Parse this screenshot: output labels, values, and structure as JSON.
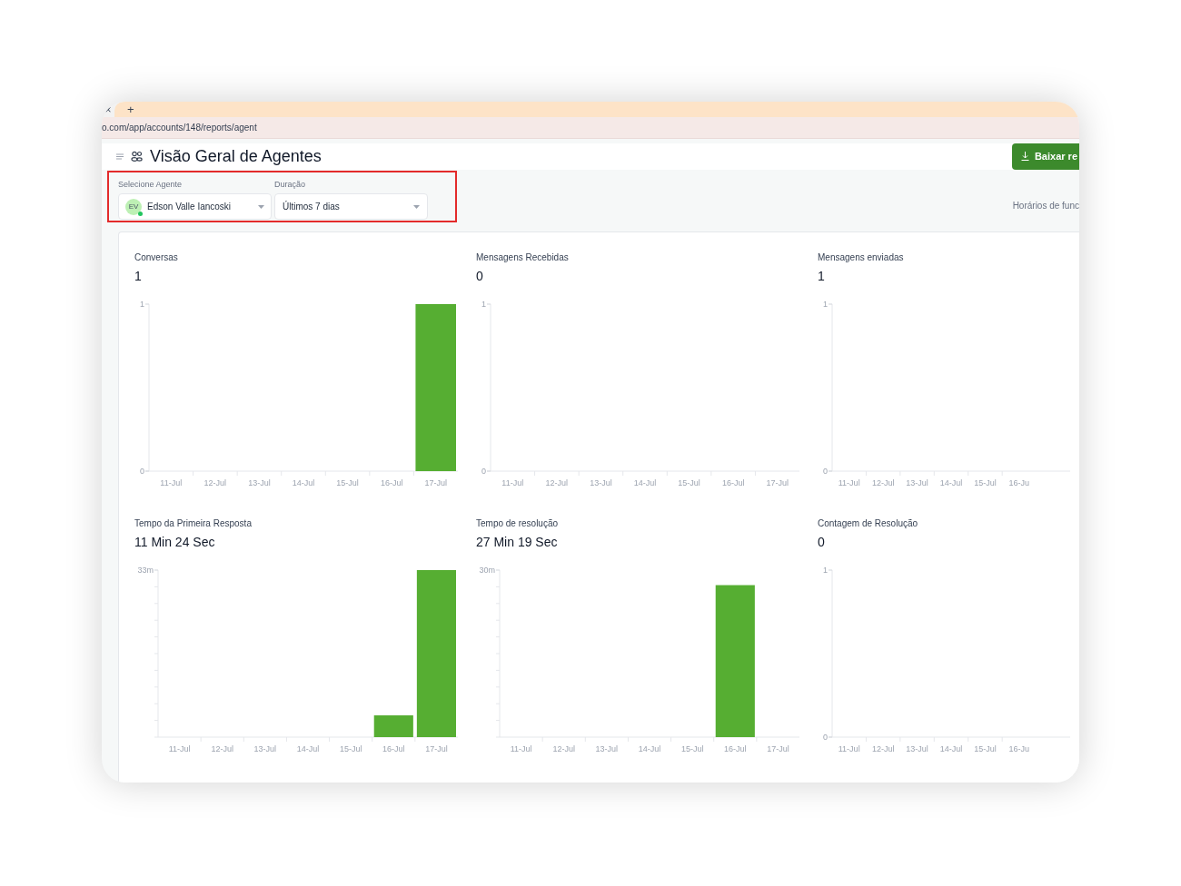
{
  "browser": {
    "tab_close": "×",
    "new_tab": "+",
    "url": "o.com/app/accounts/148/reports/agent"
  },
  "header": {
    "title": "Visão Geral de Agentes",
    "download_button": "Baixar re"
  },
  "filters": {
    "agent": {
      "label": "Selecione Agente",
      "avatar": "EV",
      "value": "Edson Valle Iancoski"
    },
    "duration": {
      "label": "Duração",
      "value": "Últimos 7 dias"
    },
    "business_hours": "Horários de func"
  },
  "metrics": [
    {
      "title": "Conversas",
      "value": "1",
      "kind": "count",
      "chart_data": {
        "type": "bar",
        "categories": [
          "11-Jul",
          "12-Jul",
          "13-Jul",
          "14-Jul",
          "15-Jul",
          "16-Jul",
          "17-Jul"
        ],
        "values": [
          0,
          0,
          0,
          0,
          0,
          0,
          1
        ],
        "ylim": [
          0,
          1
        ],
        "yticks": [
          {
            "value": 0,
            "label": "0"
          },
          {
            "value": 1,
            "label": "1"
          }
        ]
      }
    },
    {
      "title": "Mensagens Recebidas",
      "value": "0",
      "kind": "count",
      "chart_data": {
        "type": "bar",
        "categories": [
          "11-Jul",
          "12-Jul",
          "13-Jul",
          "14-Jul",
          "15-Jul",
          "16-Jul",
          "17-Jul"
        ],
        "values": [
          0,
          0,
          0,
          0,
          0,
          0,
          0
        ],
        "ylim": [
          0,
          1
        ],
        "yticks": [
          {
            "value": 0,
            "label": "0"
          },
          {
            "value": 1,
            "label": "1"
          }
        ]
      }
    },
    {
      "title": "Mensagens enviadas",
      "value": "1",
      "kind": "count",
      "chart_data": {
        "type": "bar",
        "categories": [
          "11-Jul",
          "12-Jul",
          "13-Jul",
          "14-Jul",
          "15-Jul",
          "16-Ju"
        ],
        "values": [
          0,
          0,
          0,
          0,
          0,
          0
        ],
        "ylim": [
          0,
          1
        ],
        "yticks": [
          {
            "value": 0,
            "label": "0"
          },
          {
            "value": 1,
            "label": "1"
          }
        ]
      }
    },
    {
      "title": "Tempo da Primeira Resposta",
      "value": "11 Min 24 Sec",
      "kind": "duration",
      "chart_data": {
        "type": "bar",
        "categories": [
          "11-Jul",
          "12-Jul",
          "13-Jul",
          "14-Jul",
          "15-Jul",
          "16-Jul",
          "17-Jul"
        ],
        "values": [
          0,
          0,
          0,
          0,
          0,
          4.3,
          33
        ],
        "ylim": [
          0,
          33
        ],
        "yticks": [
          {
            "value": 33,
            "label": "33m"
          }
        ]
      }
    },
    {
      "title": "Tempo de resolução",
      "value": "27 Min 19 Sec",
      "kind": "duration",
      "chart_data": {
        "type": "bar",
        "categories": [
          "11-Jul",
          "12-Jul",
          "13-Jul",
          "14-Jul",
          "15-Jul",
          "16-Jul",
          "17-Jul"
        ],
        "values": [
          0,
          0,
          0,
          0,
          0,
          27.3,
          0
        ],
        "ylim": [
          0,
          30
        ],
        "yticks": [
          {
            "value": 30,
            "label": "30m"
          }
        ]
      }
    },
    {
      "title": "Contagem de Resolução",
      "value": "0",
      "kind": "count",
      "chart_data": {
        "type": "bar",
        "categories": [
          "11-Jul",
          "12-Jul",
          "13-Jul",
          "14-Jul",
          "15-Jul",
          "16-Ju"
        ],
        "values": [
          0,
          0,
          0,
          0,
          0,
          0
        ],
        "ylim": [
          0,
          1
        ],
        "yticks": [
          {
            "value": 0,
            "label": "0"
          },
          {
            "value": 1,
            "label": "1"
          }
        ]
      }
    }
  ]
}
